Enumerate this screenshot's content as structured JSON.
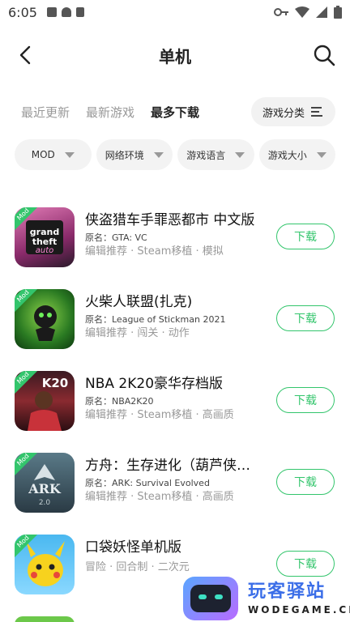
{
  "status_bar": {
    "time": "6:05"
  },
  "header": {
    "title": "单机"
  },
  "tabs": [
    {
      "label": "最近更新",
      "active": false
    },
    {
      "label": "最新游戏",
      "active": false
    },
    {
      "label": "最多下载",
      "active": true
    }
  ],
  "category_button": {
    "label": "游戏分类"
  },
  "filters": [
    {
      "label": "MOD"
    },
    {
      "label": "网络环境"
    },
    {
      "label": "游戏语言"
    },
    {
      "label": "游戏大小"
    }
  ],
  "games": [
    {
      "title": "侠盗猎车手罪恶都市 中文版",
      "original": "原名：GTA: VC",
      "tags": "编辑推荐 · Steam移植 · 模拟",
      "badge": "Mod",
      "download": "下载",
      "icon_color": "#c8448a"
    },
    {
      "title": "火柴人联盟(扎克)",
      "original": "原名：League of Stickman 2021",
      "tags": "编辑推荐 · 闯关 · 动作",
      "badge": "Mod",
      "download": "下载",
      "icon_color": "#2f8a2a"
    },
    {
      "title": "NBA 2K20豪华存档版",
      "original": "原名：NBA2K20",
      "tags": "编辑推荐 · Steam移植 · 高画质",
      "badge": "Mod",
      "download": "下载",
      "icon_color": "#6a1f2a"
    },
    {
      "title": "方舟：生存进化（葫芦侠…",
      "original": "原名：ARK: Survival Evolved",
      "tags": "编辑推荐 · Steam移植 · 高画质",
      "badge": "Mod",
      "download": "下载",
      "icon_color": "#3a5a6a"
    },
    {
      "title": "口袋妖怪单机版",
      "original": "",
      "tags": "冒险 · 回合制 · 二次元",
      "badge": "Mod",
      "download": "下载",
      "icon_color": "#f2c81e"
    }
  ],
  "watermark": {
    "name": "玩客驿站",
    "domain": "WODEGAME.CN"
  }
}
